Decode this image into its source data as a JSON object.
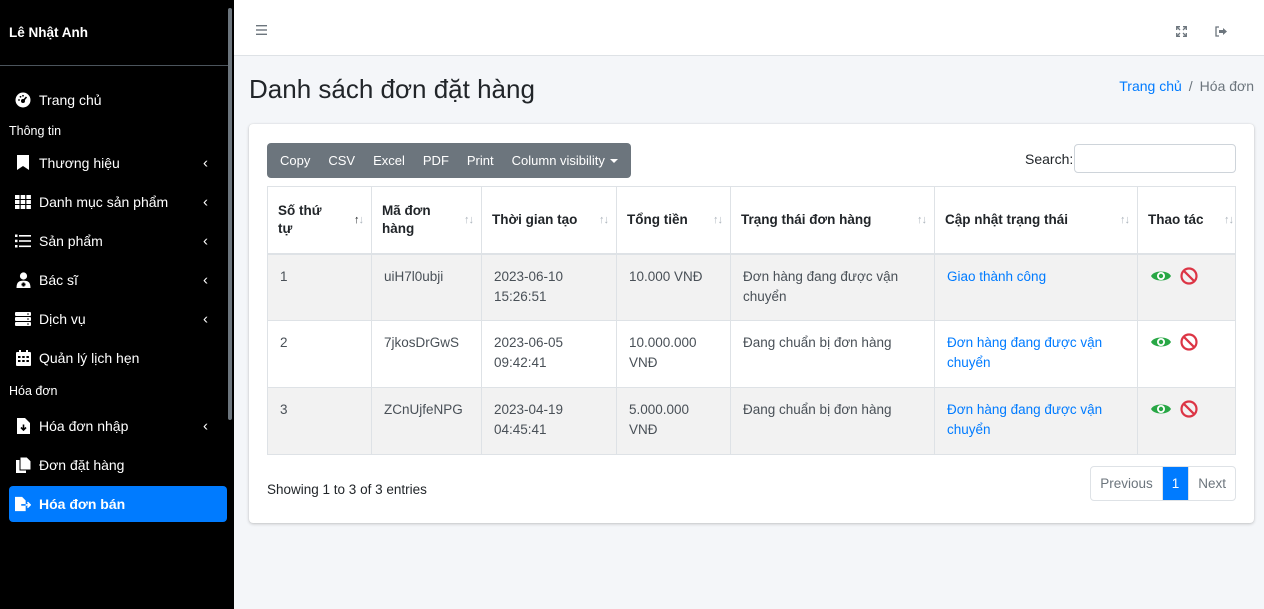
{
  "sidebar": {
    "brand": "Lê Nhật Anh",
    "home": "Trang chủ",
    "section_info": "Thông tin",
    "items_info": [
      {
        "label": "Thương hiệu"
      },
      {
        "label": "Danh mục sản phẩm"
      },
      {
        "label": "Sản phẩm"
      },
      {
        "label": "Bác sĩ"
      },
      {
        "label": "Dịch vụ"
      },
      {
        "label": "Quản lý lịch hẹn"
      }
    ],
    "section_invoice": "Hóa đơn",
    "items_invoice": [
      {
        "label": "Hóa đơn nhập"
      },
      {
        "label": "Đơn đặt hàng"
      },
      {
        "label": "Hóa đơn bán"
      }
    ]
  },
  "page": {
    "title": "Danh sách đơn đặt hàng",
    "breadcrumb": {
      "home": "Trang chủ",
      "sep": "/",
      "current": "Hóa đơn"
    }
  },
  "toolbar": {
    "buttons": [
      "Copy",
      "CSV",
      "Excel",
      "PDF",
      "Print",
      "Column visibility"
    ],
    "search_label": "Search:",
    "search_value": ""
  },
  "table": {
    "headers": [
      "Số thứ tự",
      "Mã đơn hàng",
      "Thời gian tạo",
      "Tổng tiền",
      "Trạng thái đơn hàng",
      "Cập nhật trạng thái",
      "Thao tác"
    ],
    "rows": [
      {
        "stt": "1",
        "code": "uiH7l0ubji",
        "time": "2023-06-10 15:26:51",
        "total": "10.000 VNĐ",
        "status": "Đơn hàng đang được vận chuyển",
        "update": "Giao thành công"
      },
      {
        "stt": "2",
        "code": "7jkosDrGwS",
        "time": "2023-06-05 09:42:41",
        "total": "10.000.000 VNĐ",
        "status": "Đang chuẩn bị đơn hàng",
        "update": "Đơn hàng đang được vận chuyển"
      },
      {
        "stt": "3",
        "code": "ZCnUjfeNPG",
        "time": "2023-04-19 04:45:41",
        "total": "5.000.000 VNĐ",
        "status": "Đang chuẩn bị đơn hàng",
        "update": "Đơn hàng đang được vận chuyển"
      }
    ]
  },
  "footer": {
    "info": "Showing 1 to 3 of 3 entries",
    "previous": "Previous",
    "page": "1",
    "next": "Next"
  },
  "colors": {
    "accent": "#007bff",
    "sidebar_bg": "#000000",
    "view_icon": "#28a745",
    "delete_icon": "#dc3545"
  }
}
